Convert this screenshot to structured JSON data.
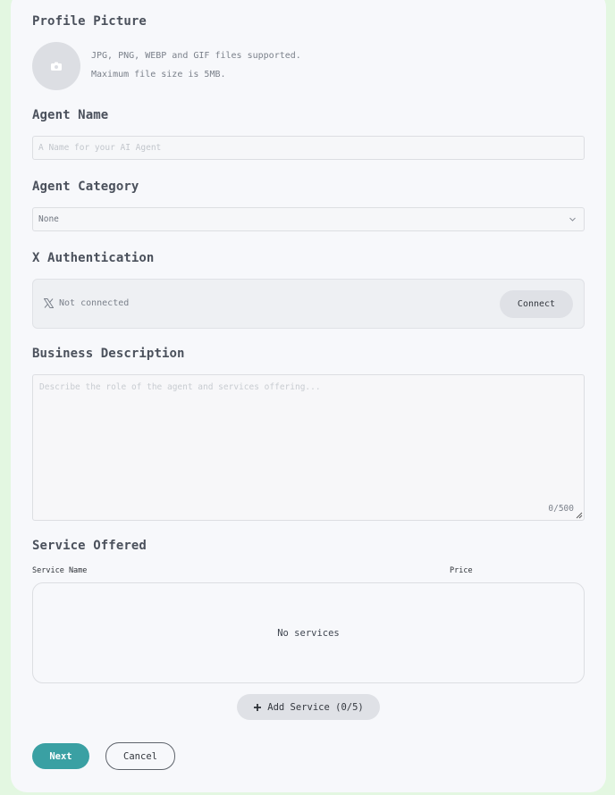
{
  "profile": {
    "heading": "Profile Picture",
    "hint_line1": "JPG, PNG, WEBP and GIF files supported.",
    "hint_line2": "Maximum file size is 5MB."
  },
  "agent_name": {
    "heading": "Agent Name",
    "placeholder": "A Name for your AI Agent",
    "value": ""
  },
  "agent_category": {
    "heading": "Agent Category",
    "selected": "None"
  },
  "x_auth": {
    "heading": "X Authentication",
    "status": "Not connected",
    "connect_label": "Connect"
  },
  "business": {
    "heading": "Business Description",
    "placeholder": "Describe the role of the agent and services offering...",
    "counter": "0/500"
  },
  "services": {
    "heading": "Service Offered",
    "col_name": "Service Name",
    "col_price": "Price",
    "empty_text": "No services",
    "add_label": "Add Service (0/5)"
  },
  "actions": {
    "next_label": "Next",
    "cancel_label": "Cancel"
  },
  "colors": {
    "primary": "#3aa0a3",
    "page_background": "#e3f7e1",
    "card_background": "#f7f8fb"
  },
  "icons": [
    "camera-icon",
    "x-logo-icon",
    "chevron-down-icon",
    "plus-icon",
    "resize-handle-icon"
  ]
}
